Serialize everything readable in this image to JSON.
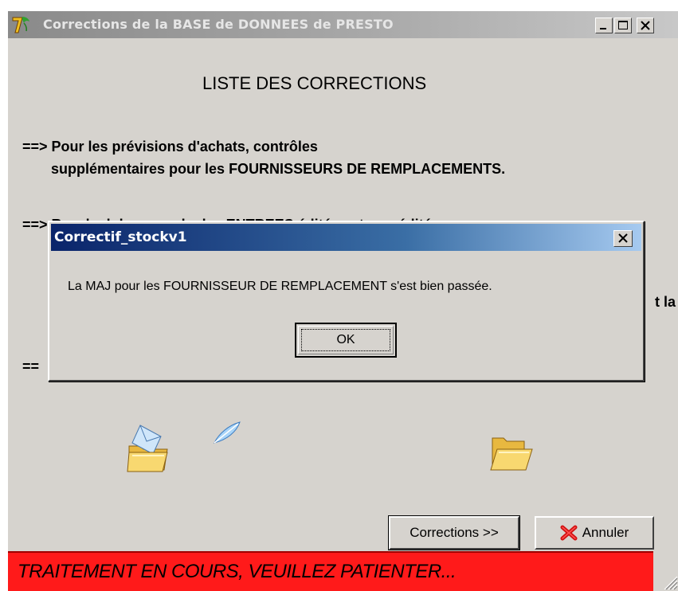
{
  "main_window": {
    "title": "Corrections de la BASE de DONNEES de PRESTO",
    "heading": "LISTE DES CORRECTIONS",
    "lines": [
      "==> Pour les prévisions d'achats, contrôles",
      "supplémentaires pour les FOURNISSEURS DE REMPLACEMENTS.",
      "==> Recalcul des cumuls des ENTREES éditées et non éditées",
      "t la",
      "=="
    ],
    "buttons": {
      "corrections": "Corrections >>",
      "annuler": "Annuler"
    },
    "status_text": "TRAITEMENT EN COURS, VEUILLEZ PATIENTER..."
  },
  "dialog": {
    "title": "Correctif_stockv1",
    "message": "La MAJ pour les FOURNISSEUR DE REMPLACEMENT s'est bien passée.",
    "ok_label": "OK"
  },
  "icons": {
    "app": "app-logo-icon",
    "folder_mail": "folder-envelope-icon",
    "feather": "feather-icon",
    "folder": "open-folder-icon",
    "cancel": "red-x-icon"
  },
  "colors": {
    "status_bar": "#ff1a1a",
    "dialog_title_start": "#0a246a",
    "dialog_title_end": "#a6caf0",
    "window_face": "#d6d3ce"
  }
}
